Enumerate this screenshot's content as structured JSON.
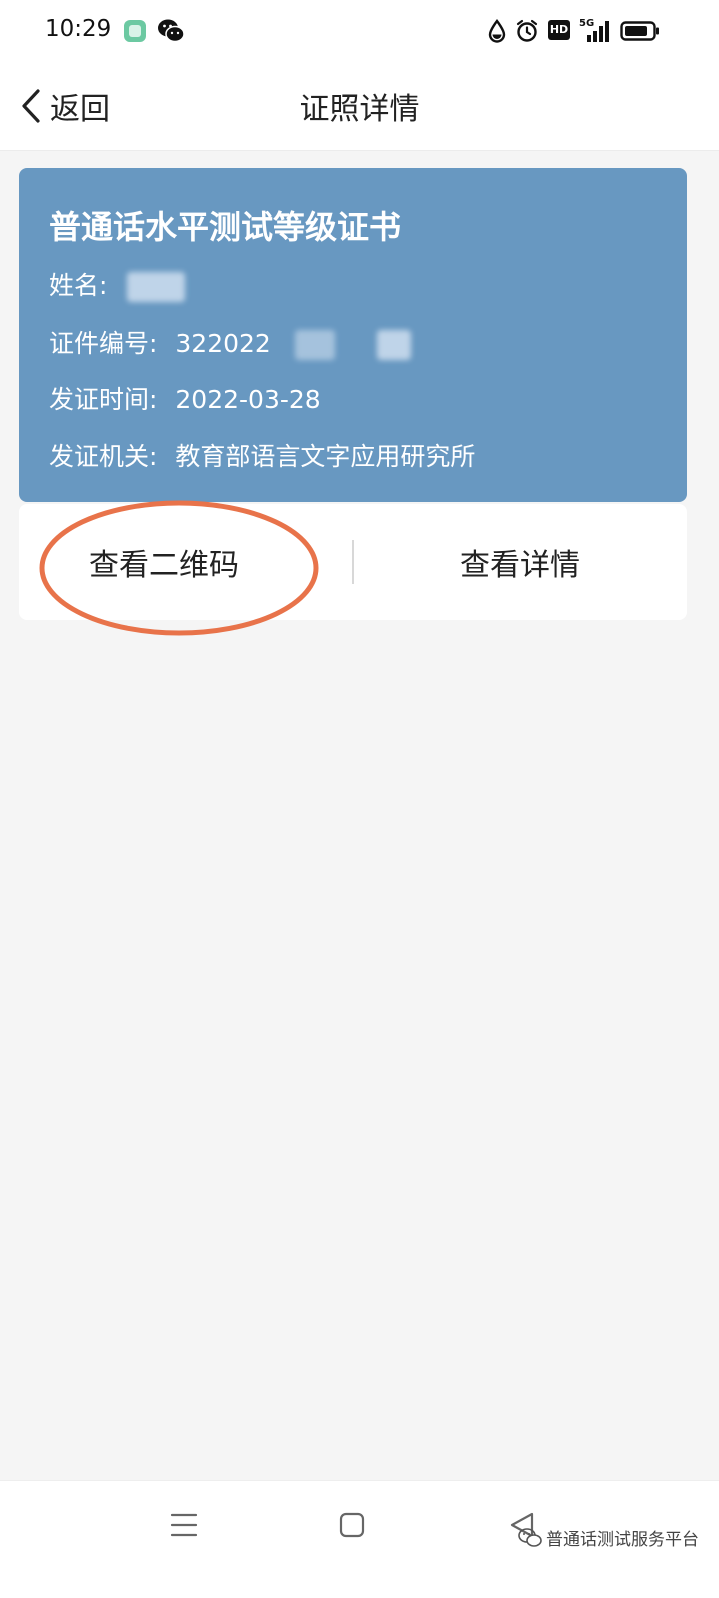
{
  "status_bar": {
    "time": "10:29",
    "network": "5G",
    "hd_label": "HD"
  },
  "nav": {
    "back_label": "返回",
    "title": "证照详情"
  },
  "certificate": {
    "title": "普通话水平测试等级证书",
    "name_label": "姓名:",
    "number_label": "证件编号:",
    "number_value": "322022",
    "issue_date_label": "发证时间:",
    "issue_date_value": "2022-03-28",
    "issuer_label": "发证机关:",
    "issuer_value": "教育部语言文字应用研究所",
    "card_color": "#6898c1"
  },
  "actions": {
    "view_qr_label": "查看二维码",
    "view_detail_label": "查看详情",
    "highlight_color": "#e8734a"
  },
  "watermark": {
    "text": "普通话测试服务平台"
  }
}
